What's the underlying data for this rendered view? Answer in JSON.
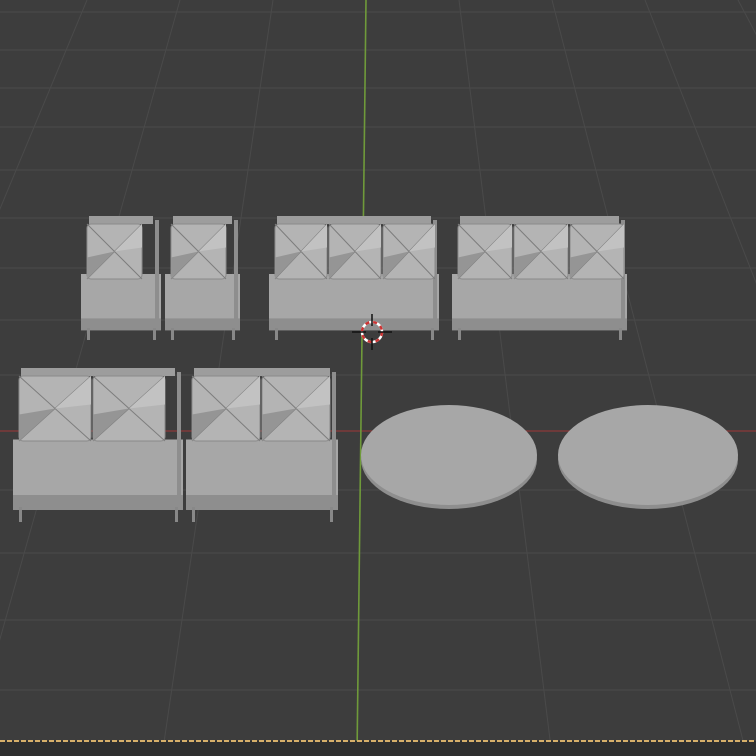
{
  "viewport": {
    "background_color": "#3d3d3d",
    "grid_color": "#4a4a4a",
    "x_axis_color": "#8b3a3a",
    "y_axis_color": "#6f9a3a",
    "timeline_edge_color": "#d8b06a",
    "object_color": "#a7a7a7"
  },
  "scene": {
    "objects": [
      {
        "name": "chair-1",
        "type": "chair",
        "seats": 1
      },
      {
        "name": "chair-2",
        "type": "chair",
        "seats": 1
      },
      {
        "name": "sofa-3-seat-1",
        "type": "sofa",
        "seats": 3
      },
      {
        "name": "sofa-3-seat-2",
        "type": "sofa",
        "seats": 3
      },
      {
        "name": "sofa-2-seat-1",
        "type": "sofa",
        "seats": 2
      },
      {
        "name": "sofa-2-seat-2",
        "type": "sofa",
        "seats": 2
      },
      {
        "name": "round-table-1",
        "type": "table"
      },
      {
        "name": "round-table-2",
        "type": "table"
      }
    ]
  }
}
